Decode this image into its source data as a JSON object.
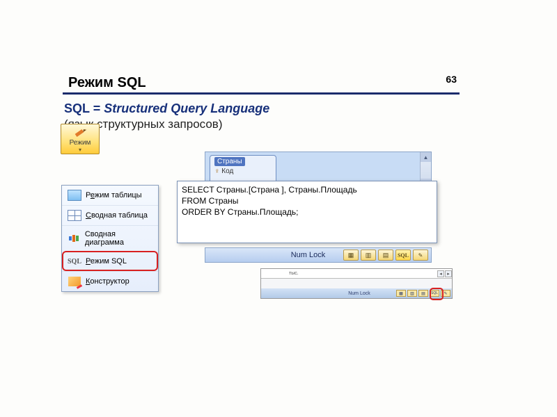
{
  "page_number": "63",
  "title": "Режим SQL",
  "subtitle": {
    "abbr": "SQL",
    "equals": " = ",
    "expansion": "Structured Query Language",
    "translation": "(язык структурных запросов)"
  },
  "menu": {
    "head_label": "Режим",
    "items": [
      {
        "id": "table",
        "label_pre": "Р",
        "label_ul": "е",
        "label_post": "жим таблицы"
      },
      {
        "id": "pivot",
        "label_pre": "",
        "label_ul": "С",
        "label_post": "водная таблица"
      },
      {
        "id": "chart",
        "label_pre": "Сво",
        "label_ul": "д",
        "label_post": "ная диаграмма"
      },
      {
        "id": "sql",
        "label_pre": "",
        "label_ul": "Р",
        "label_post": "ежим SQL"
      },
      {
        "id": "design",
        "label_pre": "",
        "label_ul": "К",
        "label_post": "онструктор"
      }
    ],
    "sql_icon_text": "SQL"
  },
  "table_fragment": {
    "table_name": "Страны",
    "key_symbol": "♀",
    "field": "Код"
  },
  "sql_query": {
    "line1": "SELECT Страны.[Страна ], Страны.Площадь",
    "line2": "FROM Страны",
    "line3": "ORDER BY Страны.Площадь;"
  },
  "status": {
    "numlock": "Num Lock",
    "sql_btn": "SQL"
  },
  "thumb": {
    "label_faint": "тыс.",
    "numlock": "Num Lock",
    "sql_btn": "SQL"
  }
}
